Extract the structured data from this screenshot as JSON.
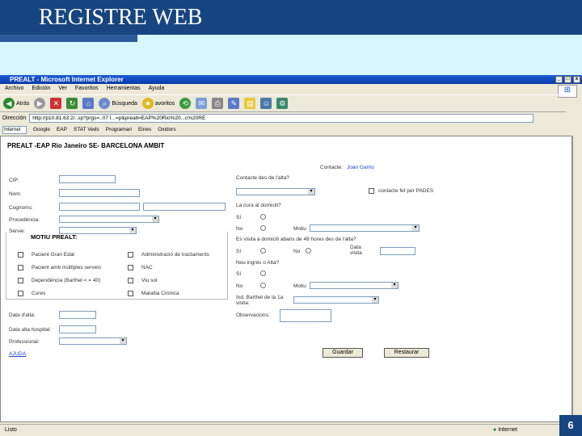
{
  "slide": {
    "title": "REGISTRE WEB",
    "page_number": "6"
  },
  "window": {
    "title": "PREALT - Microsoft Internet Explorer",
    "buttons": [
      "_",
      "□",
      "x"
    ]
  },
  "menu": [
    "Archivo",
    "Edición",
    "Ver",
    "Favoritos",
    "Herramientas",
    "Ayuda"
  ],
  "toolbar": {
    "back": "Atrás",
    "search": "Búsqueda",
    "favorites": "avoritos"
  },
  "address": {
    "label": "Dirección",
    "url": "http://p10.81.63.2/..sp?prgs=..07 I...=p&prealt=EAP%20Rio%20...c%20RE"
  },
  "linkbar": {
    "search": "Internet",
    "items": [
      "Google",
      "EAP",
      "STAT Veds",
      "Programari",
      "Eines",
      "Oxidors"
    ]
  },
  "status": {
    "left": "Listo",
    "zone": "Internet"
  },
  "form": {
    "title": "PREALT -EAP Rio Janeiro SE- BARCELONA AMBIT",
    "contact_label": "Contacte:",
    "contact_name": "Joan Garrio",
    "labels": {
      "cip": "CIP:",
      "nom": "Nom:",
      "cognoms": "Cognoms:",
      "procedencia": "Procedència:",
      "servei": "Servei:",
      "contacte_alta": "Contacte des de l'alta?",
      "contacte_paus": "contacte fet per PADES",
      "curs_domicili": "La cura al domicili?",
      "si": "Sí",
      "no": "No",
      "motiu": "Motiu",
      "visita_48h": "Es visita a domicili abans de 48 hores des de l'alta?",
      "data_visita": "Data visita",
      "nou_ingres": "Nou ingrés o Alta?",
      "ind_barthel": "Ind. Barthel de la 1a visita:",
      "data_alta": "Data d'alta:",
      "data_hospital": "Data alta hospital:",
      "professional": "Professional:",
      "observacions": "Observacions:"
    },
    "motiu_title": "MOTIU PREALT:",
    "motiu_items": [
      "Pacient Gran Edat",
      "Pacient amb múltiples serveis",
      "Dependència (Barthel < = 40)",
      "Cures",
      "Administració de tractaments",
      "NAC",
      "Viu sol",
      "Malaltia Crònica"
    ],
    "help": "AJUDA",
    "save_button": "Guardar",
    "reset_button": "Restaurar"
  },
  "colors": {
    "header": "#17457f",
    "accent": "#2d5a9a",
    "page_bg": "#d6f7fb",
    "titlebar": "#0a3aa8",
    "link": "#1f3fc8"
  }
}
